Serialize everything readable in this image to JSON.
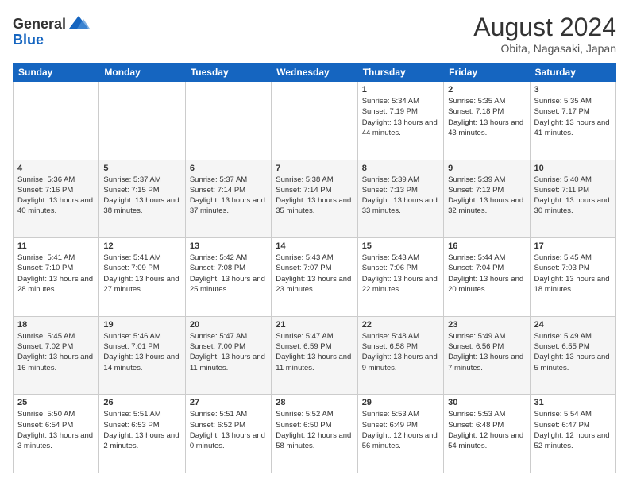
{
  "header": {
    "logo_general": "General",
    "logo_blue": "Blue",
    "month_year": "August 2024",
    "location": "Obita, Nagasaki, Japan"
  },
  "weekdays": [
    "Sunday",
    "Monday",
    "Tuesday",
    "Wednesday",
    "Thursday",
    "Friday",
    "Saturday"
  ],
  "weeks": [
    [
      {
        "day": "",
        "sunrise": "",
        "sunset": "",
        "daylight": ""
      },
      {
        "day": "",
        "sunrise": "",
        "sunset": "",
        "daylight": ""
      },
      {
        "day": "",
        "sunrise": "",
        "sunset": "",
        "daylight": ""
      },
      {
        "day": "",
        "sunrise": "",
        "sunset": "",
        "daylight": ""
      },
      {
        "day": "1",
        "sunrise": "Sunrise: 5:34 AM",
        "sunset": "Sunset: 7:19 PM",
        "daylight": "Daylight: 13 hours and 44 minutes."
      },
      {
        "day": "2",
        "sunrise": "Sunrise: 5:35 AM",
        "sunset": "Sunset: 7:18 PM",
        "daylight": "Daylight: 13 hours and 43 minutes."
      },
      {
        "day": "3",
        "sunrise": "Sunrise: 5:35 AM",
        "sunset": "Sunset: 7:17 PM",
        "daylight": "Daylight: 13 hours and 41 minutes."
      }
    ],
    [
      {
        "day": "4",
        "sunrise": "Sunrise: 5:36 AM",
        "sunset": "Sunset: 7:16 PM",
        "daylight": "Daylight: 13 hours and 40 minutes."
      },
      {
        "day": "5",
        "sunrise": "Sunrise: 5:37 AM",
        "sunset": "Sunset: 7:15 PM",
        "daylight": "Daylight: 13 hours and 38 minutes."
      },
      {
        "day": "6",
        "sunrise": "Sunrise: 5:37 AM",
        "sunset": "Sunset: 7:14 PM",
        "daylight": "Daylight: 13 hours and 37 minutes."
      },
      {
        "day": "7",
        "sunrise": "Sunrise: 5:38 AM",
        "sunset": "Sunset: 7:14 PM",
        "daylight": "Daylight: 13 hours and 35 minutes."
      },
      {
        "day": "8",
        "sunrise": "Sunrise: 5:39 AM",
        "sunset": "Sunset: 7:13 PM",
        "daylight": "Daylight: 13 hours and 33 minutes."
      },
      {
        "day": "9",
        "sunrise": "Sunrise: 5:39 AM",
        "sunset": "Sunset: 7:12 PM",
        "daylight": "Daylight: 13 hours and 32 minutes."
      },
      {
        "day": "10",
        "sunrise": "Sunrise: 5:40 AM",
        "sunset": "Sunset: 7:11 PM",
        "daylight": "Daylight: 13 hours and 30 minutes."
      }
    ],
    [
      {
        "day": "11",
        "sunrise": "Sunrise: 5:41 AM",
        "sunset": "Sunset: 7:10 PM",
        "daylight": "Daylight: 13 hours and 28 minutes."
      },
      {
        "day": "12",
        "sunrise": "Sunrise: 5:41 AM",
        "sunset": "Sunset: 7:09 PM",
        "daylight": "Daylight: 13 hours and 27 minutes."
      },
      {
        "day": "13",
        "sunrise": "Sunrise: 5:42 AM",
        "sunset": "Sunset: 7:08 PM",
        "daylight": "Daylight: 13 hours and 25 minutes."
      },
      {
        "day": "14",
        "sunrise": "Sunrise: 5:43 AM",
        "sunset": "Sunset: 7:07 PM",
        "daylight": "Daylight: 13 hours and 23 minutes."
      },
      {
        "day": "15",
        "sunrise": "Sunrise: 5:43 AM",
        "sunset": "Sunset: 7:06 PM",
        "daylight": "Daylight: 13 hours and 22 minutes."
      },
      {
        "day": "16",
        "sunrise": "Sunrise: 5:44 AM",
        "sunset": "Sunset: 7:04 PM",
        "daylight": "Daylight: 13 hours and 20 minutes."
      },
      {
        "day": "17",
        "sunrise": "Sunrise: 5:45 AM",
        "sunset": "Sunset: 7:03 PM",
        "daylight": "Daylight: 13 hours and 18 minutes."
      }
    ],
    [
      {
        "day": "18",
        "sunrise": "Sunrise: 5:45 AM",
        "sunset": "Sunset: 7:02 PM",
        "daylight": "Daylight: 13 hours and 16 minutes."
      },
      {
        "day": "19",
        "sunrise": "Sunrise: 5:46 AM",
        "sunset": "Sunset: 7:01 PM",
        "daylight": "Daylight: 13 hours and 14 minutes."
      },
      {
        "day": "20",
        "sunrise": "Sunrise: 5:47 AM",
        "sunset": "Sunset: 7:00 PM",
        "daylight": "Daylight: 13 hours and 11 minutes."
      },
      {
        "day": "21",
        "sunrise": "Sunrise: 5:47 AM",
        "sunset": "Sunset: 6:59 PM",
        "daylight": "Daylight: 13 hours and 11 minutes."
      },
      {
        "day": "22",
        "sunrise": "Sunrise: 5:48 AM",
        "sunset": "Sunset: 6:58 PM",
        "daylight": "Daylight: 13 hours and 9 minutes."
      },
      {
        "day": "23",
        "sunrise": "Sunrise: 5:49 AM",
        "sunset": "Sunset: 6:56 PM",
        "daylight": "Daylight: 13 hours and 7 minutes."
      },
      {
        "day": "24",
        "sunrise": "Sunrise: 5:49 AM",
        "sunset": "Sunset: 6:55 PM",
        "daylight": "Daylight: 13 hours and 5 minutes."
      }
    ],
    [
      {
        "day": "25",
        "sunrise": "Sunrise: 5:50 AM",
        "sunset": "Sunset: 6:54 PM",
        "daylight": "Daylight: 13 hours and 3 minutes."
      },
      {
        "day": "26",
        "sunrise": "Sunrise: 5:51 AM",
        "sunset": "Sunset: 6:53 PM",
        "daylight": "Daylight: 13 hours and 2 minutes."
      },
      {
        "day": "27",
        "sunrise": "Sunrise: 5:51 AM",
        "sunset": "Sunset: 6:52 PM",
        "daylight": "Daylight: 13 hours and 0 minutes."
      },
      {
        "day": "28",
        "sunrise": "Sunrise: 5:52 AM",
        "sunset": "Sunset: 6:50 PM",
        "daylight": "Daylight: 12 hours and 58 minutes."
      },
      {
        "day": "29",
        "sunrise": "Sunrise: 5:53 AM",
        "sunset": "Sunset: 6:49 PM",
        "daylight": "Daylight: 12 hours and 56 minutes."
      },
      {
        "day": "30",
        "sunrise": "Sunrise: 5:53 AM",
        "sunset": "Sunset: 6:48 PM",
        "daylight": "Daylight: 12 hours and 54 minutes."
      },
      {
        "day": "31",
        "sunrise": "Sunrise: 5:54 AM",
        "sunset": "Sunset: 6:47 PM",
        "daylight": "Daylight: 12 hours and 52 minutes."
      }
    ]
  ]
}
